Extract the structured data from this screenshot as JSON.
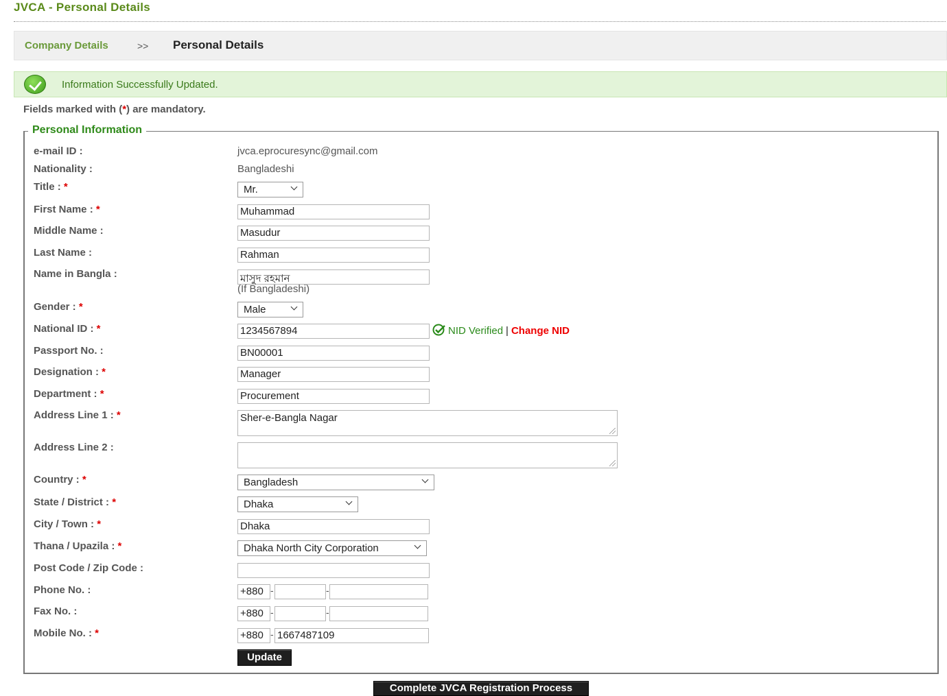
{
  "page": {
    "title": "JVCA - Personal Details"
  },
  "breadcrumb": {
    "link": "Company Details",
    "separator": ">>",
    "current": "Personal Details"
  },
  "message": {
    "success": "Information Successfully Updated."
  },
  "mandatory_note": {
    "prefix": "Fields marked with (",
    "star": "*",
    "suffix": ") are mandatory."
  },
  "section": {
    "legend": "Personal Information"
  },
  "labels": {
    "email": "e-mail ID :",
    "nationality": "Nationality :",
    "title": "Title : ",
    "first_name": "First Name : ",
    "middle_name": "Middle Name :",
    "last_name": "Last Name :",
    "name_bangla": "Name in Bangla :",
    "gender": "Gender : ",
    "national_id": "National ID : ",
    "passport": "Passport No. :",
    "designation": "Designation : ",
    "department": "Department : ",
    "address1": "Address Line 1 : ",
    "address2": "Address Line 2 :",
    "country": "Country : ",
    "state": "State / District : ",
    "city": "City / Town : ",
    "thana": "Thana / Upazila : ",
    "postcode": "Post Code / Zip Code :",
    "phone": "Phone No. :",
    "fax": "Fax No. :",
    "mobile": "Mobile No. : ",
    "required_mark": "*"
  },
  "values": {
    "email": "jvca.eprocuresync@gmail.com",
    "nationality": "Bangladeshi",
    "title": "Mr.",
    "first_name": "Muhammad",
    "middle_name": "Masudur",
    "last_name": "Rahman",
    "name_bangla": "মাসুদ রহমান",
    "name_bangla_hint": "(If Bangladeshi)",
    "gender": "Male",
    "national_id": "1234567894",
    "passport": "BN00001",
    "designation": "Manager",
    "department": "Procurement",
    "address1": "Sher-e-Bangla Nagar",
    "address2": "",
    "country": "Bangladesh",
    "state": "Dhaka",
    "city": "Dhaka",
    "thana": "Dhaka North City Corporation",
    "postcode": "",
    "phone_prefix": "+880",
    "fax_prefix": "+880",
    "mobile_prefix": "+880",
    "mobile": "1667487109",
    "dash": "-"
  },
  "nid": {
    "verified": "NID Verified",
    "pipe": "|",
    "change": "Change NID",
    "icon": "check-circle-icon"
  },
  "buttons": {
    "update": "Update",
    "complete": "Complete JVCA Registration Process"
  },
  "colors": {
    "title_green": "#5a8a1a",
    "legend_green": "#2f8a1a",
    "required_red": "#dd0000",
    "success_bg": "#e3f4d9",
    "button_bg": "#1f1f1f"
  }
}
